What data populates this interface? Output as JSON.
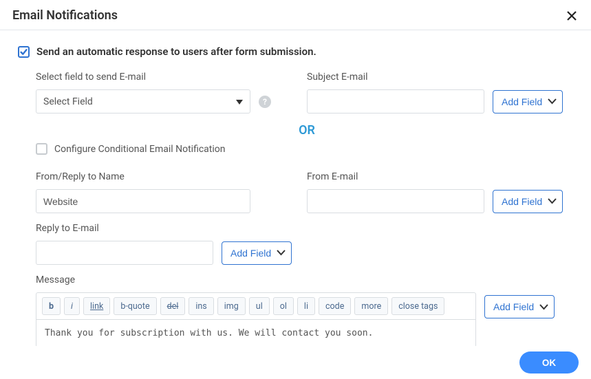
{
  "dialog": {
    "title": "Email Notifications",
    "close_icon": "close"
  },
  "send_automatic": {
    "checked": true,
    "label": "Send an automatic response to users after form submission."
  },
  "select_field": {
    "label": "Select field to send E-mail",
    "value": "Select Field",
    "help": "?"
  },
  "subject": {
    "label": "Subject E-mail",
    "value": "",
    "add": "Add Field"
  },
  "or": "OR",
  "conditional": {
    "checked": false,
    "label": "Configure Conditional Email Notification"
  },
  "from_name": {
    "label": "From/Reply to Name",
    "value": "Website"
  },
  "from_email": {
    "label": "From E-mail",
    "value": "",
    "add": "Add Field"
  },
  "reply_email": {
    "label": "Reply to E-mail",
    "value": "",
    "add": "Add Field"
  },
  "message": {
    "label": "Message",
    "add": "Add Field",
    "body": "Thank you for subscription with us. We will contact you soon.",
    "toolbar": {
      "b": "b",
      "i": "i",
      "link": "link",
      "bquote": "b-quote",
      "del": "del",
      "ins": "ins",
      "img": "img",
      "ul": "ul",
      "ol": "ol",
      "li": "li",
      "code": "code",
      "more": "more",
      "closetags": "close tags"
    }
  },
  "footer": {
    "ok": "OK"
  }
}
